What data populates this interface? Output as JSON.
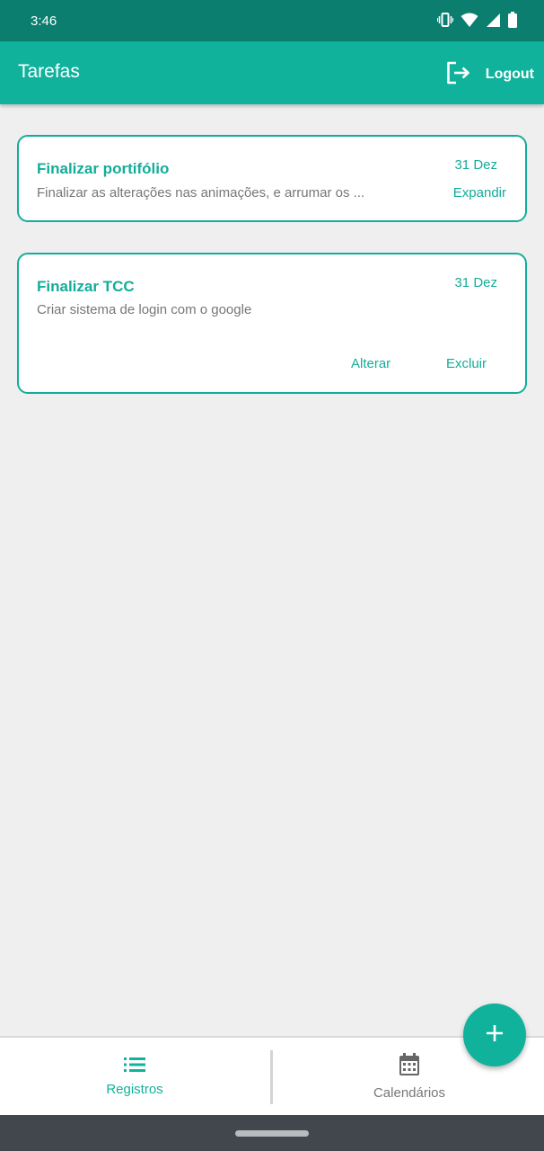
{
  "status_bar": {
    "time": "3:46",
    "icons": [
      "vibrate-icon",
      "wifi-icon",
      "signal-icon",
      "battery-icon"
    ]
  },
  "app_bar": {
    "title": "Tarefas",
    "logout_label": "Logout",
    "logout_icon": "logout-icon"
  },
  "tasks": [
    {
      "title": "Finalizar portifólio",
      "description": "Finalizar as alterações nas animações, e arrumar os ...",
      "date": "31 Dez",
      "actions": [
        "Expandir"
      ]
    },
    {
      "title": "Finalizar TCC",
      "description": "Criar sistema de login com o google",
      "date": "31 Dez",
      "actions": [
        "Alterar",
        "Excluir"
      ]
    }
  ],
  "fab": {
    "icon": "plus-icon"
  },
  "bottom_nav": {
    "items": [
      {
        "label": "Registros",
        "icon": "list-icon",
        "active": true
      },
      {
        "label": "Calendários",
        "icon": "calendar-icon",
        "active": false
      }
    ]
  },
  "colors": {
    "primary": "#10b29c",
    "status_bar": "#0b7e6f",
    "background": "#efefef",
    "text_muted": "#777777",
    "nav_inactive": "#777777",
    "system_nav": "#41474c"
  }
}
